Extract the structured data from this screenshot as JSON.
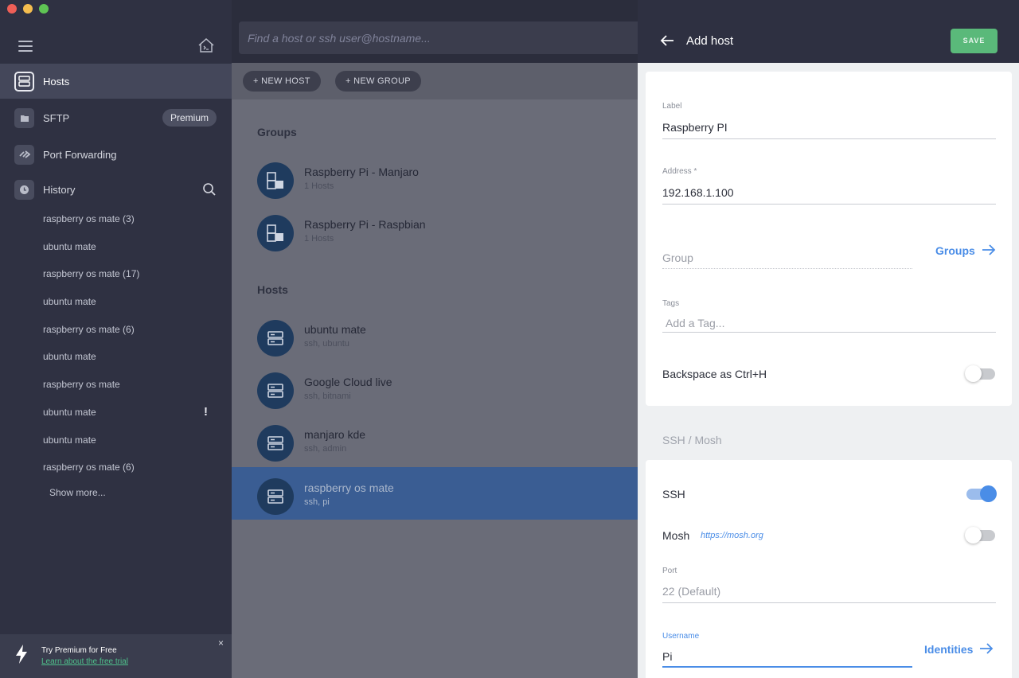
{
  "sidebar": {
    "nav": [
      {
        "label": "Hosts",
        "icon": "server-icon"
      },
      {
        "label": "SFTP",
        "icon": "folder-icon"
      },
      {
        "label": "Port Forwarding",
        "icon": "forward-icon"
      },
      {
        "label": "History",
        "icon": "clock-icon"
      }
    ],
    "premium_badge": "Premium",
    "history": [
      "raspberry os mate (3)",
      "ubuntu mate",
      "raspberry os mate (17)",
      "ubuntu mate",
      "raspberry os mate (6)",
      "ubuntu mate",
      "raspberry os mate",
      "ubuntu mate",
      "ubuntu mate",
      "raspberry os mate (6)"
    ],
    "history_warning": "!",
    "show_more": "Show more...",
    "promo": {
      "title": "Try Premium for Free",
      "link": "Learn about the free trial",
      "close": "×"
    }
  },
  "search": {
    "placeholder": "Find a host or ssh user@hostname..."
  },
  "toolbar": {
    "new_host": "+ NEW HOST",
    "new_group": "+ NEW GROUP"
  },
  "groups_title": "Groups",
  "groups": [
    {
      "title": "Raspberry Pi - Manjaro",
      "sub": "1 Hosts"
    },
    {
      "title": "Raspberry Pi - Raspbian",
      "sub": "1 Hosts"
    }
  ],
  "hosts_title": "Hosts",
  "hosts": [
    {
      "title": "ubuntu mate",
      "sub": "ssh, ubuntu"
    },
    {
      "title": "Google Cloud live",
      "sub": "ssh, bitnami"
    },
    {
      "title": "manjaro kde",
      "sub": "ssh, admin"
    },
    {
      "title": "raspberry os mate",
      "sub": "ssh, pi"
    }
  ],
  "panel": {
    "title": "Add host",
    "save": "SAVE",
    "label_label": "Label",
    "label_value": "Raspberry PI",
    "address_label": "Address *",
    "address_value": "192.168.1.100",
    "group_placeholder": "Group",
    "groups_link": "Groups",
    "tags_label": "Tags",
    "tags_placeholder": "Add a Tag...",
    "backspace_label": "Backspace as Ctrl+H",
    "backspace_on": false,
    "ssh_section": "SSH / Mosh",
    "ssh_label": "SSH",
    "ssh_on": true,
    "mosh_label": "Mosh",
    "mosh_link": "https://mosh.org",
    "mosh_on": false,
    "port_label": "Port",
    "port_placeholder": "22 (Default)",
    "username_label": "Username",
    "username_value": "Pi",
    "identities_link": "Identities"
  },
  "colors": {
    "accent": "#4a8de7",
    "save": "#5ab97a",
    "sidebar": "#2f3142",
    "selected_row": "#3a5d93"
  }
}
